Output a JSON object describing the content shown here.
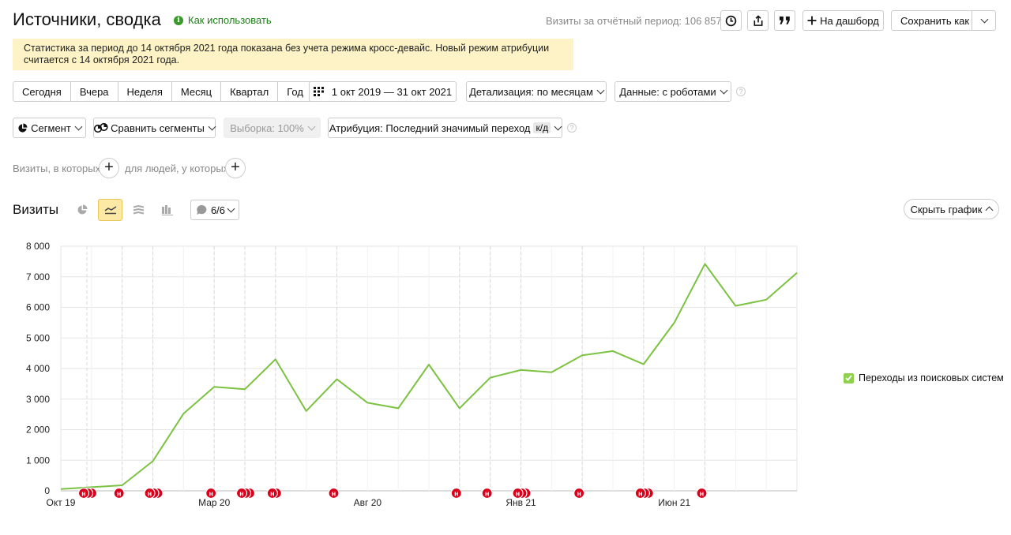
{
  "header": {
    "title": "Источники, сводка",
    "howto_label": "Как использовать",
    "visits_total": "Визиты за отчётный период: 106 857",
    "dashboard_label": "На дашборд",
    "save_as_label": "Сохранить как"
  },
  "notice": {
    "text": "Статистика за период до 14 октября 2021 года показана без учета режима кросс-девайс. Новый режим атрибуции считается с 14 октября 2021 года."
  },
  "periods": [
    "Сегодня",
    "Вчера",
    "Неделя",
    "Месяц",
    "Квартал",
    "Год"
  ],
  "filters": {
    "date_range": "1 окт 2019 — 31 окт 2021",
    "detail": "Детализация: по месяцам",
    "data": "Данные: с роботами",
    "segment": "Сегмент",
    "compare": "Сравнить сегменты",
    "sample": "Выборка: 100%",
    "attribution": "Атрибуция: Последний значимый переход",
    "attribution_badge": "к/д"
  },
  "conditions": {
    "visits_label": "Визиты, в которых",
    "people_label": "для людей, у которых"
  },
  "chart_section": {
    "title": "Визиты",
    "annotations_label": "6/6",
    "hide_label": "Скрыть график"
  },
  "colors": {
    "line": "#7cc242",
    "marker": "#d9001b",
    "notice_bg": "#fdf3c6",
    "active_btn": "#fde9a6"
  },
  "chart_data": {
    "type": "line",
    "xlabel": "",
    "ylabel": "",
    "ylim": [
      0,
      8000
    ],
    "yticks": [
      "0",
      "1 000",
      "2 000",
      "3 000",
      "4 000",
      "5 000",
      "6 000",
      "7 000",
      "8 000"
    ],
    "xtick_labels": [
      {
        "label": "Окт 19",
        "index": 0
      },
      {
        "label": "Мар 20",
        "index": 5
      },
      {
        "label": "Авг 20",
        "index": 10
      },
      {
        "label": "Янв 21",
        "index": 15
      },
      {
        "label": "Июн 21",
        "index": 20
      }
    ],
    "x": [
      "2019-10",
      "2019-11",
      "2019-12",
      "2020-01",
      "2020-02",
      "2020-03",
      "2020-04",
      "2020-05",
      "2020-06",
      "2020-07",
      "2020-08",
      "2020-09",
      "2020-10",
      "2020-11",
      "2020-12",
      "2021-01",
      "2021-02",
      "2021-03",
      "2021-04",
      "2021-05",
      "2021-06",
      "2021-07",
      "2021-08",
      "2021-09",
      "2021-10"
    ],
    "series": [
      {
        "name": "Переходы из поисковых систем",
        "values": [
          60,
          120,
          180,
          970,
          2520,
          3400,
          3320,
          4300,
          2610,
          3650,
          2880,
          2700,
          4130,
          2700,
          3700,
          3950,
          3880,
          4430,
          4570,
          4140,
          5500,
          7420,
          6050,
          6250,
          7130
        ]
      }
    ],
    "annotation_markers": [
      {
        "month_pos": 0.85,
        "count": 3
      },
      {
        "month_pos": 2.0,
        "count": 1
      },
      {
        "month_pos": 3.0,
        "count": 3
      },
      {
        "month_pos": 5.0,
        "count": 1
      },
      {
        "month_pos": 6.0,
        "count": 3
      },
      {
        "month_pos": 7.0,
        "count": 2
      },
      {
        "month_pos": 9.0,
        "count": 1
      },
      {
        "month_pos": 13.0,
        "count": 1
      },
      {
        "month_pos": 14.0,
        "count": 1
      },
      {
        "month_pos": 15.0,
        "count": 3
      },
      {
        "month_pos": 17.0,
        "count": 1
      },
      {
        "month_pos": 19.0,
        "count": 3
      },
      {
        "month_pos": 21.0,
        "count": 1
      }
    ],
    "marker_letter": "н",
    "grid": true,
    "legend_position": "right"
  }
}
